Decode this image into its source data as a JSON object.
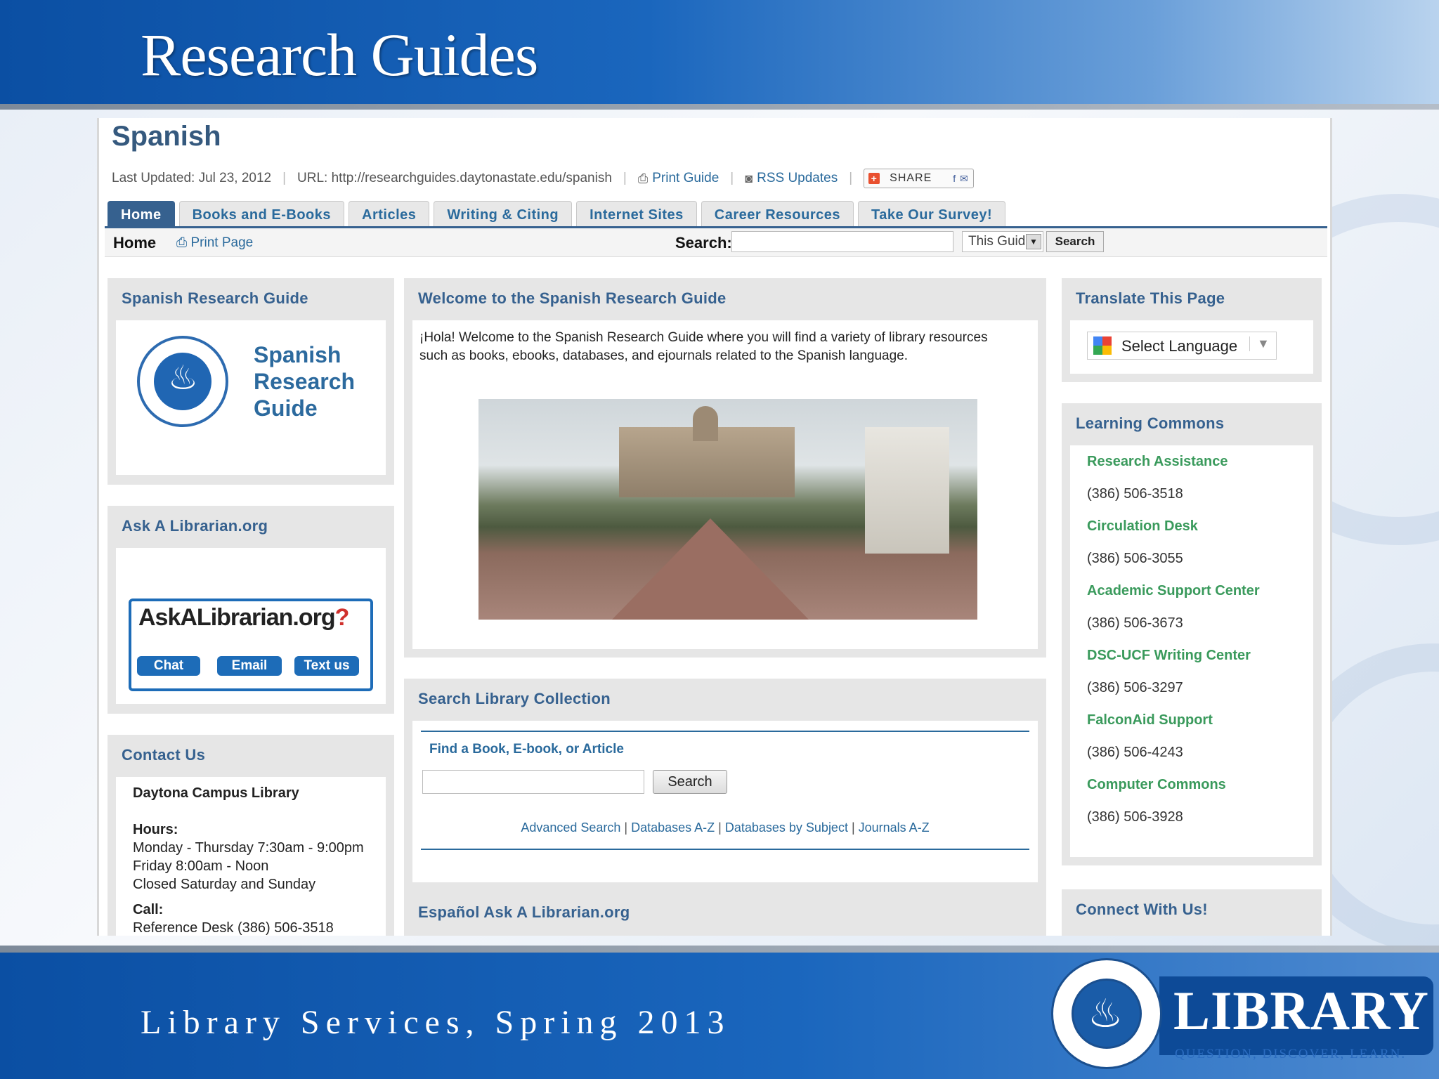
{
  "slide": {
    "title": "Research Guides",
    "footer": "Library Services, Spring 2013",
    "logo_word": "LIBRARY",
    "logo_tagline": "QUESTION, DISCOVER, LEARN."
  },
  "guide": {
    "title": "Spanish",
    "last_updated": "Last Updated: Jul 23, 2012",
    "url": "URL: http://researchguides.daytonastate.edu/spanish",
    "print_guide": "Print Guide",
    "rss": "RSS Updates",
    "share": "SHARE"
  },
  "tabs": [
    {
      "label": "Home",
      "active": true
    },
    {
      "label": "Books and E-Books"
    },
    {
      "label": "Articles"
    },
    {
      "label": "Writing & Citing"
    },
    {
      "label": "Internet Sites"
    },
    {
      "label": "Career Resources"
    },
    {
      "label": "Take Our Survey!"
    }
  ],
  "subbar": {
    "home": "Home",
    "print_page": "Print Page",
    "search_label": "Search:",
    "scope": "This Guide",
    "search_button": "Search"
  },
  "left": {
    "research_guide": {
      "title": "Spanish Research Guide",
      "logo_line1": "Spanish",
      "logo_line2": "Research",
      "logo_line3": "Guide"
    },
    "ask": {
      "title": "Ask A Librarian.org",
      "logo": "AskALibrarian.org",
      "chat": "Chat",
      "email": "Email",
      "text": "Text us"
    },
    "contact": {
      "title": "Contact Us",
      "location": "Daytona Campus Library",
      "hours_label": "Hours:",
      "hours_1": "Monday - Thursday 7:30am - 9:00pm",
      "hours_2": "Friday 8:00am - Noon",
      "hours_3": "Closed Saturday and Sunday",
      "call_label": "Call:",
      "call_1": "Reference Desk (386) 506-3518"
    }
  },
  "center": {
    "welcome": {
      "title": "Welcome to the Spanish Research Guide",
      "text": "¡Hola! Welcome to the Spanish Research Guide where you will find a variety of library resources such as books, ebooks, databases, and ejournals related to the Spanish language."
    },
    "search_collection": {
      "title": "Search Library Collection",
      "label": "Find a Book, E-book, or Article",
      "button": "Search",
      "links": [
        "Advanced Search",
        "Databases A-Z",
        "Databases by Subject",
        "Journals A-Z"
      ]
    },
    "espanol": {
      "title": "Español Ask A Librarian.org"
    }
  },
  "right": {
    "translate": {
      "title": "Translate This Page",
      "select": "Select Language"
    },
    "learning_commons": {
      "title": "Learning Commons",
      "items": [
        {
          "name": "Research Assistance",
          "phone": "(386) 506-3518"
        },
        {
          "name": "Circulation Desk",
          "phone": "(386) 506-3055"
        },
        {
          "name": "Academic Support Center",
          "phone": "(386) 506-3673"
        },
        {
          "name": "DSC-UCF Writing Center",
          "phone": "(386) 506-3297"
        },
        {
          "name": "FalconAid Support",
          "phone": "(386) 506-4243"
        },
        {
          "name": "Computer Commons",
          "phone": "(386) 506-3928"
        }
      ]
    },
    "connect": {
      "title": "Connect With Us!"
    }
  },
  "colors": {
    "slide_blue": "#0b4fa3",
    "heading_blue": "#36618f",
    "link_green": "#3a9a5c",
    "tab_active": "#36618f"
  }
}
